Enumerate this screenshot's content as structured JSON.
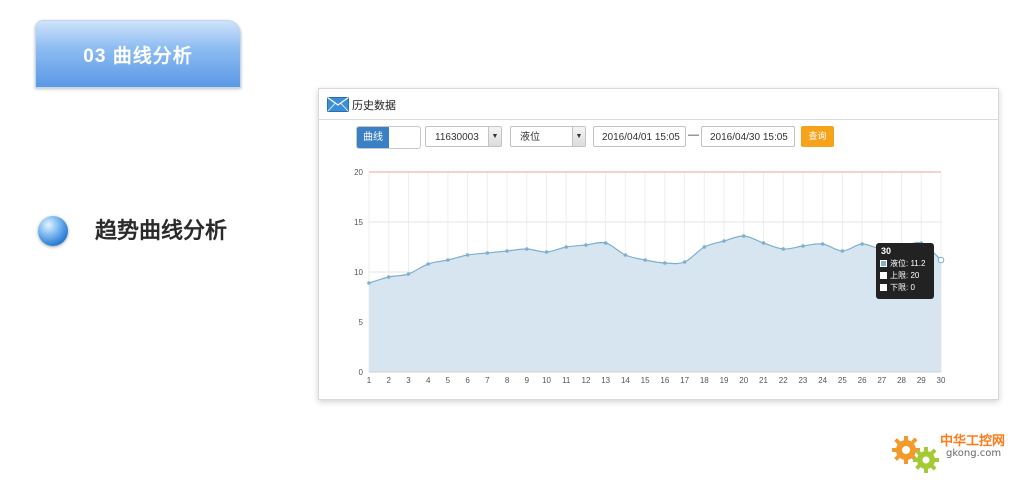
{
  "section": {
    "tab_label": "03  曲线分析"
  },
  "heading": {
    "text": "趋势曲线分析"
  },
  "panel": {
    "title": "历史数据",
    "toggle_label": "曲线",
    "device_value": "11630003",
    "param_value": "液位",
    "date_from": "2016/04/01 15:05",
    "date_separator": "—",
    "date_to": "2016/04/30 15:05",
    "query_label": "查询"
  },
  "chart_data": {
    "type": "area",
    "x": [
      1,
      2,
      3,
      4,
      5,
      6,
      7,
      8,
      9,
      10,
      11,
      12,
      13,
      14,
      15,
      16,
      17,
      18,
      19,
      20,
      21,
      22,
      23,
      24,
      25,
      26,
      27,
      28,
      29,
      30
    ],
    "x_tick_labels": [
      "1",
      "2",
      "3",
      "4",
      "5",
      "6",
      "7",
      "8",
      "9",
      "10",
      "11",
      "12",
      "13",
      "14",
      "15",
      "16",
      "17",
      "18",
      "19",
      "20",
      "21",
      "22",
      "23",
      "24",
      "25",
      "26",
      "27",
      "28",
      "29",
      "30"
    ],
    "series": [
      {
        "name": "液位",
        "values": [
          8.9,
          9.5,
          9.8,
          10.8,
          11.2,
          11.7,
          11.9,
          12.1,
          12.3,
          12.0,
          12.5,
          12.7,
          12.9,
          11.7,
          11.2,
          10.9,
          11.0,
          12.5,
          13.1,
          13.6,
          12.9,
          12.3,
          12.6,
          12.8,
          12.1,
          12.8,
          12.3,
          12.5,
          12.9,
          11.2
        ],
        "color": "#7fb0cf"
      },
      {
        "name": "上限",
        "values": [
          20,
          20,
          20,
          20,
          20,
          20,
          20,
          20,
          20,
          20,
          20,
          20,
          20,
          20,
          20,
          20,
          20,
          20,
          20,
          20,
          20,
          20,
          20,
          20,
          20,
          20,
          20,
          20,
          20,
          20
        ],
        "color": "#f2a0a0"
      },
      {
        "name": "下限",
        "values": [
          0,
          0,
          0,
          0,
          0,
          0,
          0,
          0,
          0,
          0,
          0,
          0,
          0,
          0,
          0,
          0,
          0,
          0,
          0,
          0,
          0,
          0,
          0,
          0,
          0,
          0,
          0,
          0,
          0,
          0
        ],
        "color": "#d0d0d0"
      }
    ],
    "y_ticks": [
      "0",
      "5",
      "10",
      "15",
      "20"
    ],
    "ylim": [
      0,
      20
    ],
    "xlim": [
      1,
      30
    ],
    "grid": true,
    "fill_color": "#d6e5f0"
  },
  "tooltip": {
    "title": "30",
    "rows": [
      {
        "label": "液位",
        "value": "11.2"
      },
      {
        "label": "上限",
        "value": "20"
      },
      {
        "label": "下限",
        "value": "0"
      }
    ],
    "swatch_colors": [
      "#7fb0cf",
      "#ffffff",
      "#ffffff"
    ]
  },
  "logo": {
    "text": "中华工控网",
    "domain": "gkong.com"
  }
}
